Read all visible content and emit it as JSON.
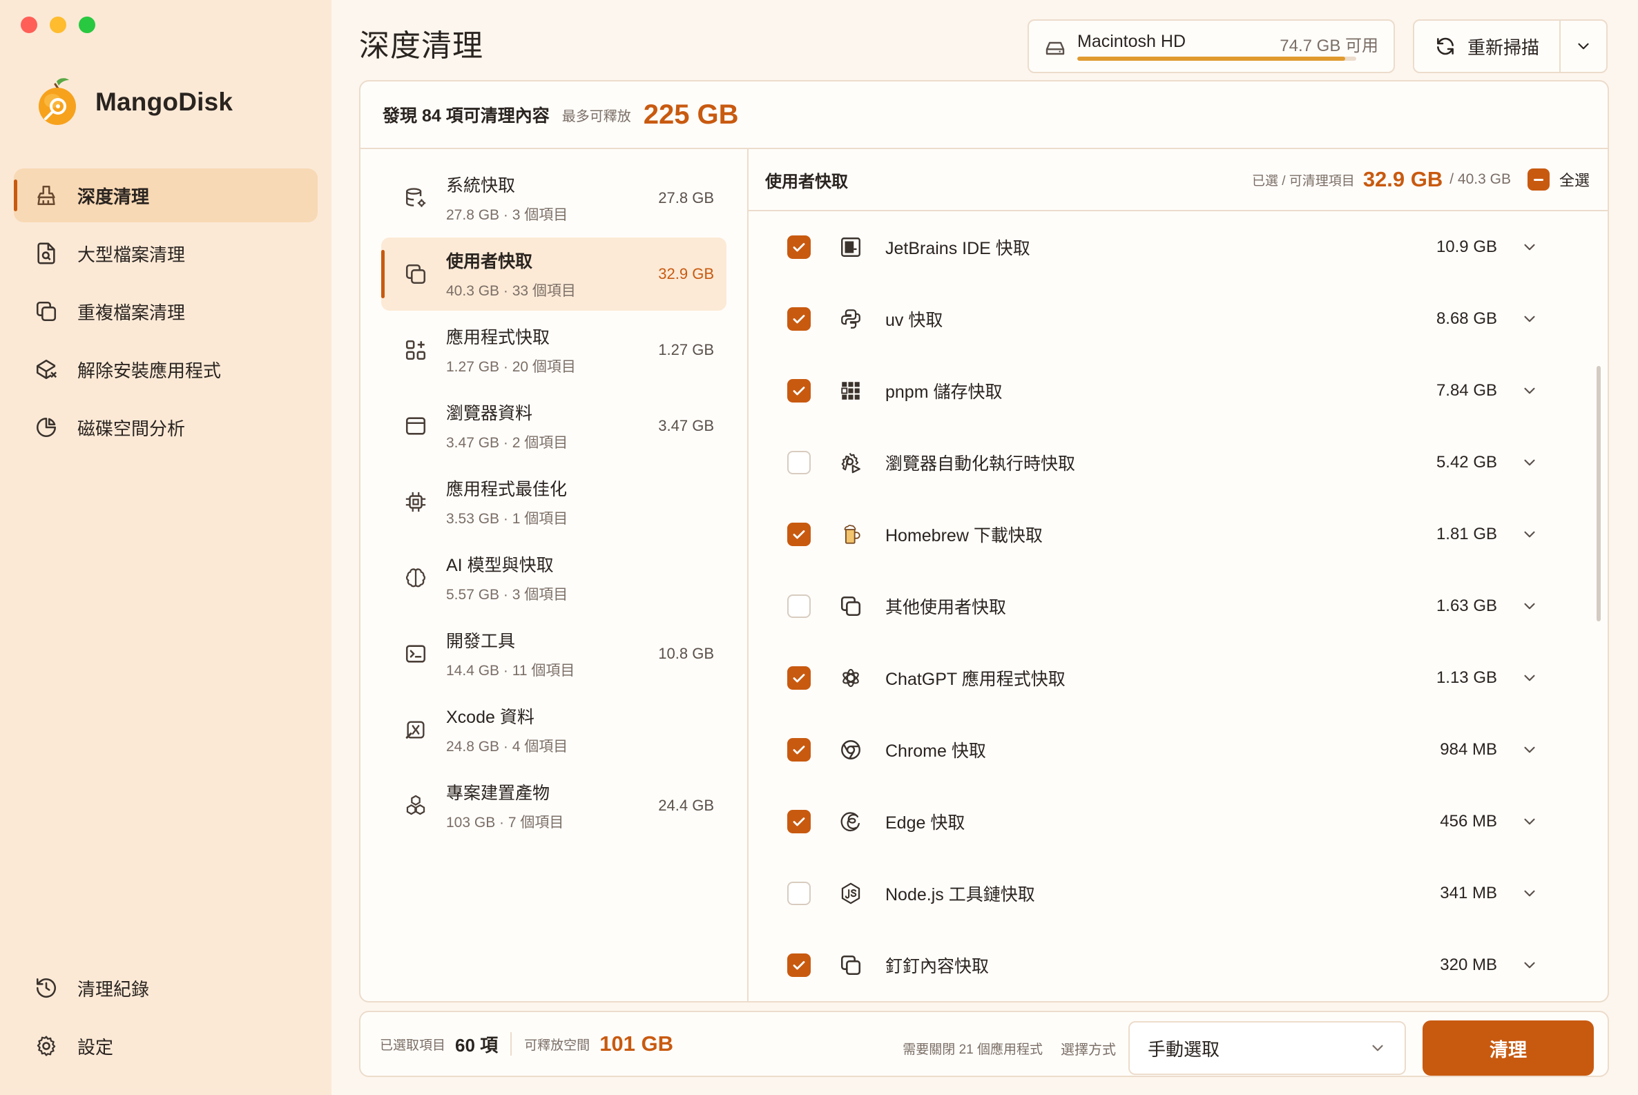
{
  "app": {
    "name": "MangoDisk",
    "brand_color": "#c85a10",
    "accent_amber": "#e09a2e"
  },
  "window_controls": [
    {
      "name": "close",
      "color": "#ff5f57"
    },
    {
      "name": "minimize",
      "color": "#febc2e"
    },
    {
      "name": "zoom",
      "color": "#28c840"
    }
  ],
  "sidebar": {
    "items": [
      {
        "label": "深度清理",
        "icon": "broom-icon",
        "active": true
      },
      {
        "label": "大型檔案清理",
        "icon": "file-search-icon",
        "active": false
      },
      {
        "label": "重複檔案清理",
        "icon": "copy-icon",
        "active": false
      },
      {
        "label": "解除安裝應用程式",
        "icon": "package-x-icon",
        "active": false
      },
      {
        "label": "磁碟空間分析",
        "icon": "pie-chart-icon",
        "active": false
      }
    ],
    "bottom": [
      {
        "label": "清理紀錄",
        "icon": "history-icon"
      },
      {
        "label": "設定",
        "icon": "gear-icon"
      }
    ]
  },
  "header": {
    "title": "深度清理",
    "disk": {
      "name": "Macintosh HD",
      "free": "74.7 GB 可用",
      "used_fraction": 0.96
    },
    "rescan_label": "重新掃描"
  },
  "summary": {
    "found": "發現 84 項可清理內容",
    "max_label": "最多可釋放",
    "max_size": "225 GB"
  },
  "categories": [
    {
      "name": "系統快取",
      "sub": "27.8 GB · 3 個項目",
      "size": "27.8 GB",
      "icon": "database-gear-icon",
      "active": false
    },
    {
      "name": "使用者快取",
      "sub": "40.3 GB · 33 個項目",
      "size": "32.9 GB",
      "icon": "copy-icon",
      "active": true
    },
    {
      "name": "應用程式快取",
      "sub": "1.27 GB · 20 個項目",
      "size": "1.27 GB",
      "icon": "grid-plus-icon",
      "active": false
    },
    {
      "name": "瀏覽器資料",
      "sub": "3.47 GB · 2 個項目",
      "size": "3.47 GB",
      "icon": "browser-icon",
      "active": false
    },
    {
      "name": "應用程式最佳化",
      "sub": "3.53 GB · 1 個項目",
      "size": "",
      "icon": "chip-icon",
      "active": false
    },
    {
      "name": "AI 模型與快取",
      "sub": "5.57 GB · 3 個項目",
      "size": "",
      "icon": "brain-icon",
      "active": false
    },
    {
      "name": "開發工具",
      "sub": "14.4 GB · 11 個項目",
      "size": "10.8 GB",
      "icon": "terminal-icon",
      "active": false
    },
    {
      "name": "Xcode 資料",
      "sub": "24.8 GB · 4 個項目",
      "size": "",
      "icon": "xcode-icon",
      "active": false
    },
    {
      "name": "專案建置產物",
      "sub": "103 GB · 7 個項目",
      "size": "24.4 GB",
      "icon": "boxes-icon",
      "active": false
    }
  ],
  "detail": {
    "title": "使用者快取",
    "stat_label": "已選 / 可清理項目",
    "selected": "32.9 GB",
    "total": "/ 40.3 GB",
    "select_all": "全選",
    "items": [
      {
        "name": "JetBrains IDE 快取",
        "size": "10.9 GB",
        "checked": true,
        "icon": "jetbrains-icon"
      },
      {
        "name": "uv 快取",
        "size": "8.68 GB",
        "checked": true,
        "icon": "python-icon"
      },
      {
        "name": "pnpm 儲存快取",
        "size": "7.84 GB",
        "checked": true,
        "icon": "pnpm-icon"
      },
      {
        "name": "瀏覽器自動化執行時快取",
        "size": "5.42 GB",
        "checked": false,
        "icon": "gear-play-icon"
      },
      {
        "name": "Homebrew 下載快取",
        "size": "1.81 GB",
        "checked": true,
        "icon": "beer-icon"
      },
      {
        "name": "其他使用者快取",
        "size": "1.63 GB",
        "checked": false,
        "icon": "copy-icon"
      },
      {
        "name": "ChatGPT 應用程式快取",
        "size": "1.13 GB",
        "checked": true,
        "icon": "openai-icon"
      },
      {
        "name": "Chrome 快取",
        "size": "984 MB",
        "checked": true,
        "icon": "chrome-icon"
      },
      {
        "name": "Edge 快取",
        "size": "456 MB",
        "checked": true,
        "icon": "edge-icon"
      },
      {
        "name": "Node.js 工具鏈快取",
        "size": "341 MB",
        "checked": false,
        "icon": "nodejs-icon"
      },
      {
        "name": "釘釘內容快取",
        "size": "320 MB",
        "checked": true,
        "icon": "copy-icon"
      }
    ]
  },
  "footer": {
    "selected_label": "已選取項目",
    "selected_count": "60 項",
    "free_label": "可釋放空間",
    "free_size": "101 GB",
    "need_close": "需要關閉 21 個應用程式",
    "mode_label": "選擇方式",
    "mode_value": "手動選取",
    "clean_label": "清理"
  }
}
